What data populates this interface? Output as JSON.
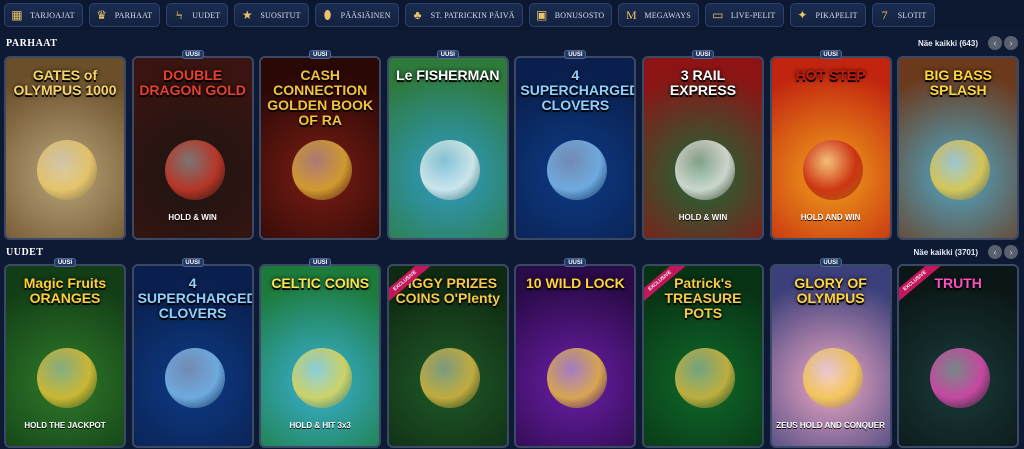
{
  "nav": [
    {
      "label": "TARJOAJAT",
      "icon": "building-icon",
      "glyph": "▦"
    },
    {
      "label": "PARHAAT",
      "icon": "crown-icon",
      "glyph": "♛"
    },
    {
      "label": "UUDET",
      "icon": "lightning-icon",
      "glyph": "ϟ"
    },
    {
      "label": "SUOSITUT",
      "icon": "star-icon",
      "glyph": "★"
    },
    {
      "label": "PÄÄSIÄINEN",
      "icon": "egg-icon",
      "glyph": "⬮"
    },
    {
      "label": "ST. PATRICKIN PÄIVÄ",
      "icon": "clover-icon",
      "glyph": "♣"
    },
    {
      "label": "BONUSOSTO",
      "icon": "chest-icon",
      "glyph": "▣"
    },
    {
      "label": "MEGAWAYS",
      "icon": "megaways-icon",
      "glyph": "M"
    },
    {
      "label": "LIVE-PELIT",
      "icon": "tv-icon",
      "glyph": "▭"
    },
    {
      "label": "PIKAPELIT",
      "icon": "gamepad-icon",
      "glyph": "✦"
    },
    {
      "label": "SLOTIT",
      "icon": "seven-icon",
      "glyph": "7"
    }
  ],
  "sections": [
    {
      "title": "PARHAAT",
      "see_all": "Näe kaikki (643)",
      "games": [
        {
          "title": "GATES of OLYMPUS 1000",
          "sub": "",
          "new": false,
          "new_label": "",
          "exclusive": false,
          "bg1": "#b9a57a",
          "bg2": "#6b4f2a",
          "tc": "#f6d36b"
        },
        {
          "title": "DOUBLE DRAGON GOLD",
          "sub": "HOLD & WIN",
          "new": true,
          "new_label": "UUSI",
          "exclusive": false,
          "bg1": "#1c1512",
          "bg2": "#3a1410",
          "tc": "#e6402e"
        },
        {
          "title": "CASH CONNECTION GOLDEN BOOK OF RA",
          "sub": "",
          "new": true,
          "new_label": "UUSI",
          "exclusive": false,
          "bg1": "#7a1d14",
          "bg2": "#2a0806",
          "tc": "#f3c33b"
        },
        {
          "title": "Le FISHERMAN",
          "sub": "",
          "new": true,
          "new_label": "UUSI",
          "exclusive": false,
          "bg1": "#2f9bc9",
          "bg2": "#2e7a3b",
          "tc": "#ffffff"
        },
        {
          "title": "4 SUPERCHARGED CLOVERS",
          "sub": "",
          "new": true,
          "new_label": "UUSI",
          "exclusive": false,
          "bg1": "#0d3b86",
          "bg2": "#0a1f4d",
          "tc": "#8fd0ff"
        },
        {
          "title": "3 RAIL EXPRESS",
          "sub": "HOLD & WIN",
          "new": true,
          "new_label": "UUSI",
          "exclusive": false,
          "bg1": "#1a6b3a",
          "bg2": "#8c1414",
          "tc": "#ffffff"
        },
        {
          "title": "HOT STEP",
          "sub": "HOLD AND WIN",
          "new": true,
          "new_label": "UUSI",
          "exclusive": false,
          "bg1": "#f2a11c",
          "bg2": "#c2250f",
          "tc": "#c31a0f"
        },
        {
          "title": "BIG BASS SPLASH",
          "sub": "",
          "new": false,
          "new_label": "",
          "exclusive": false,
          "bg1": "#4fa9c9",
          "bg2": "#6b3a1d",
          "tc": "#ffd53d"
        }
      ]
    },
    {
      "title": "UUDET",
      "see_all": "Näe kaikki (3701)",
      "games": [
        {
          "title": "Magic Fruits ORANGES",
          "sub": "HOLD THE JACKPOT",
          "new": true,
          "new_label": "UUSI",
          "exclusive": false,
          "bg1": "#2f7a2a",
          "bg2": "#123d16",
          "tc": "#ffcf3a"
        },
        {
          "title": "4 SUPERCHARGED CLOVERS",
          "sub": "",
          "new": true,
          "new_label": "UUSI",
          "exclusive": false,
          "bg1": "#0d3b86",
          "bg2": "#0a1f4d",
          "tc": "#8fd0ff"
        },
        {
          "title": "CELTIC COINS",
          "sub": "HOLD & HIT 3x3",
          "new": true,
          "new_label": "UUSI",
          "exclusive": false,
          "bg1": "#3bb1d6",
          "bg2": "#1c7a3a",
          "tc": "#ffe14d"
        },
        {
          "title": "PIGGY PRIZES COINS O'Plenty",
          "sub": "",
          "new": false,
          "new_label": "",
          "exclusive": true,
          "excl_label": "EXCLUSIVE",
          "bg1": "#1f5a28",
          "bg2": "#0f2a12",
          "tc": "#f7c948"
        },
        {
          "title": "10 WILD LOCK",
          "sub": "",
          "new": true,
          "new_label": "UUSI",
          "exclusive": false,
          "bg1": "#6b1fa8",
          "bg2": "#2a0a47",
          "tc": "#ffd33a"
        },
        {
          "title": "Patrick's TREASURE POTS",
          "sub": "",
          "new": false,
          "new_label": "",
          "exclusive": true,
          "excl_label": "EXCLUSIVE",
          "bg1": "#0f6a2a",
          "bg2": "#083214",
          "tc": "#f7c948"
        },
        {
          "title": "GLORY OF OLYMPUS",
          "sub": "ZEUS HOLD AND CONQUER",
          "new": true,
          "new_label": "UUSI",
          "exclusive": false,
          "bg1": "#f0a9c4",
          "bg2": "#3b3f7a",
          "tc": "#ffd53d"
        },
        {
          "title": "TRUTH",
          "sub": "",
          "new": false,
          "new_label": "",
          "exclusive": true,
          "excl_label": "EXCLUSIVE",
          "bg1": "#1a3a3a",
          "bg2": "#0b1616",
          "tc": "#ff4fc3"
        }
      ]
    }
  ]
}
